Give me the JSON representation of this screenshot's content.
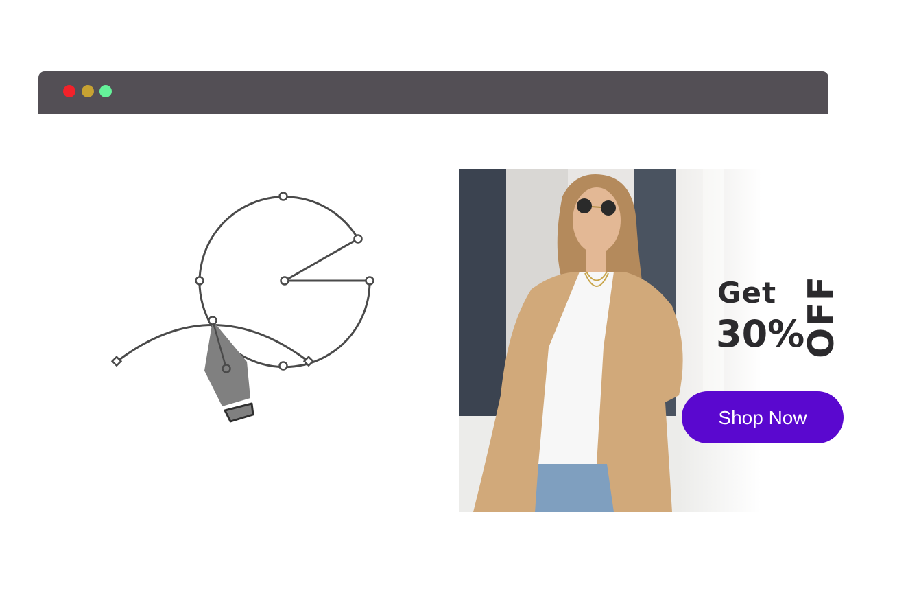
{
  "window": {
    "controls": [
      {
        "name": "close",
        "color": "#f2222a"
      },
      {
        "name": "minimize",
        "color": "#c7a232"
      },
      {
        "name": "maximize",
        "color": "#65f29a"
      }
    ],
    "bar_color": "#534f55"
  },
  "illustration": {
    "icon": "pen-tool-icon"
  },
  "banner": {
    "get": "Get",
    "percent": "30%",
    "off": "OFF",
    "button_label": "Shop Now",
    "button_color": "#5a08cf",
    "text_color": "#2b2a2d",
    "photo_icon": "fashion-model-photo"
  }
}
